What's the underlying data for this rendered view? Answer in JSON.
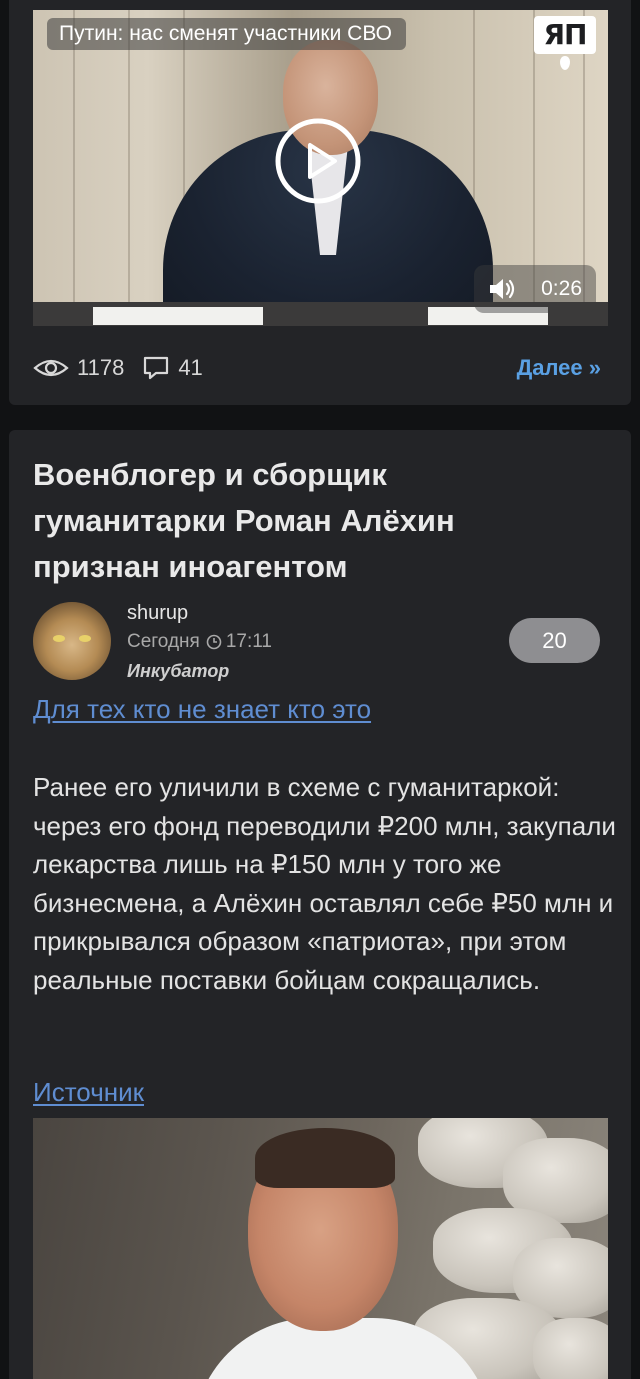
{
  "video_card": {
    "video_title": "Путин: нас сменят участники СВО",
    "brand_logo_text": "ЯП",
    "duration": "0:26",
    "views": "1178",
    "comments": "41",
    "more_label": "Далее »"
  },
  "article": {
    "title": "Военблогер и сборщик гуманитарки Роман Алёхин признан иноагентом",
    "author": "shurup",
    "date_label": "Сегодня",
    "time": "17:11",
    "community": "Инкубатор",
    "rating": "20",
    "intro_link": "Для тех кто не знает кто это",
    "body": "Ранее его уличили в схеме с гуманитаркой: через его фонд переводили ₽200 млн, закупали лекарства лишь на ₽150 млн у того же бизнесмена, а Алёхин оставлял себе ₽50 млн и прикрывался образом «патриота», при этом реальные поставки бойцам сокращались.",
    "source_link": "Источник"
  },
  "colors": {
    "page_background": "#111214",
    "card_background": "#232427",
    "link": "#5f8dd1",
    "more_link": "#5aa0e3",
    "rating_badge": "#8e8e91"
  },
  "icons": [
    "play-icon",
    "volume-icon",
    "eye-icon",
    "comment-icon",
    "clock-icon"
  ]
}
